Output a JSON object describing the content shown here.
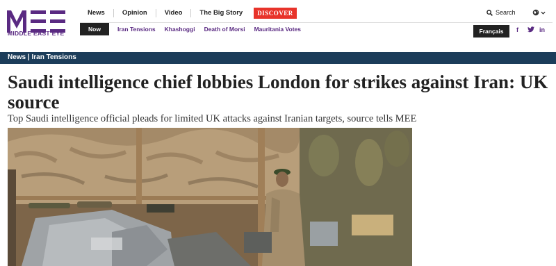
{
  "site": {
    "logo_text": "MEE",
    "tagline": "MIDDLE EAST EYE",
    "brand_color": "#5a2a82"
  },
  "nav": {
    "primary": [
      "News",
      "Opinion",
      "Video",
      "The Big Story"
    ],
    "discover_label": "DISCOVER",
    "search_label": "Search",
    "now_label": "Now",
    "topics": [
      "Iran Tensions",
      "Khashoggi",
      "Death of Morsi",
      "Mauritania Votes"
    ],
    "language_button": "Français",
    "social": [
      "f",
      "t",
      "in"
    ]
  },
  "breadcrumb": "News | Iran Tensions",
  "article": {
    "headline": "Saudi intelligence chief lobbies London for strikes against Iran: UK source",
    "standfirst": "Top Saudi intelligence official pleads for limited UK attacks against Iranian targets, source tells MEE"
  },
  "colors": {
    "breadcrumb_bg": "#1c3d5a",
    "discover_bg": "#e8332a",
    "dark_button": "#222222"
  }
}
